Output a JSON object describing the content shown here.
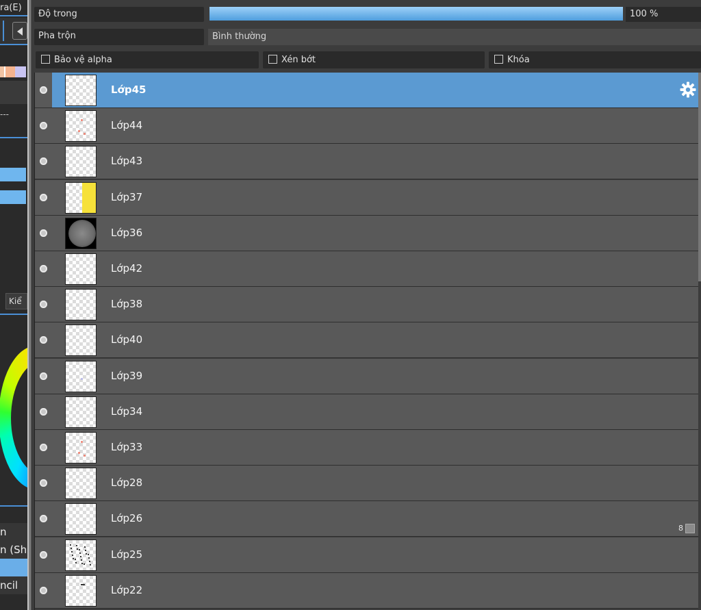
{
  "left_panel": {
    "menu_fragment": "ra(E)",
    "tab_fragment": "Kiể",
    "dash_text": "---",
    "swatch_colors": [
      "#f2c4a4",
      "#ffffff",
      "#f5b48f",
      "#c9c4f2"
    ],
    "brush_items": [
      {
        "label": "n",
        "selected": false
      },
      {
        "label": "n (Sh",
        "selected": false
      },
      {
        "label": "",
        "selected": true
      },
      {
        "label": "ncil",
        "selected": false
      }
    ]
  },
  "layer_panel": {
    "opacity_label": "Độ trong",
    "opacity_value": "100 %",
    "opacity_percent": 100,
    "blend_label": "Pha trộn",
    "blend_value": "Bình thường",
    "checkboxes": [
      {
        "label": "Bảo vệ alpha",
        "checked": false
      },
      {
        "label": "Xén bớt",
        "checked": false
      },
      {
        "label": "Khóa",
        "checked": false
      }
    ],
    "layers": [
      {
        "name": "Lớp45",
        "selected": true,
        "thumb": "empty"
      },
      {
        "name": "Lớp44",
        "selected": false,
        "thumb": "dots"
      },
      {
        "name": "Lớp43",
        "selected": false,
        "thumb": "empty"
      },
      {
        "name": "Lớp37",
        "selected": false,
        "thumb": "yellow"
      },
      {
        "name": "Lớp36",
        "selected": false,
        "thumb": "dark"
      },
      {
        "name": "Lớp42",
        "selected": false,
        "thumb": "empty"
      },
      {
        "name": "Lớp38",
        "selected": false,
        "thumb": "empty"
      },
      {
        "name": "Lớp40",
        "selected": false,
        "thumb": "empty"
      },
      {
        "name": "Lớp39",
        "selected": false,
        "thumb": "faint"
      },
      {
        "name": "Lớp34",
        "selected": false,
        "thumb": "empty"
      },
      {
        "name": "Lớp33",
        "selected": false,
        "thumb": "dots"
      },
      {
        "name": "Lớp28",
        "selected": false,
        "thumb": "empty"
      },
      {
        "name": "Lớp26",
        "selected": false,
        "thumb": "empty"
      },
      {
        "name": "Lớp25",
        "selected": false,
        "thumb": "sketch"
      },
      {
        "name": "Lớp22",
        "selected": false,
        "thumb": "mark"
      }
    ],
    "corner_indicator": "8",
    "accent_color": "#5b9ad2"
  }
}
